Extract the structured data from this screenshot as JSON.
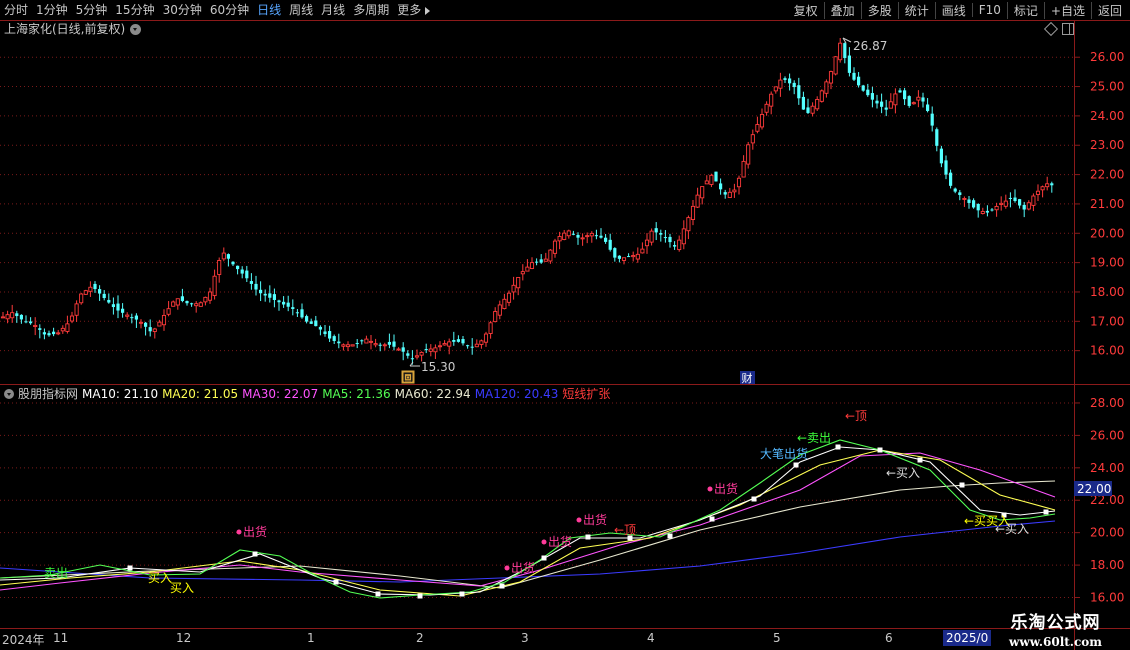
{
  "toolbar": {
    "periods": [
      "分时",
      "1分钟",
      "5分钟",
      "15分钟",
      "30分钟",
      "60分钟",
      "日线",
      "周线",
      "月线",
      "多周期",
      "更多"
    ],
    "active_period": "日线",
    "right_buttons": [
      "复权",
      "叠加",
      "多股",
      "统计",
      "画线",
      "F10",
      "标记",
      "+自选",
      "返回"
    ]
  },
  "stock_title": "上海家化(日线,前复权)",
  "main_chart": {
    "high_label": "26.87",
    "low_label": "15.30",
    "price_ticks": [
      "26.00",
      "25.00",
      "24.00",
      "23.00",
      "22.00",
      "21.00",
      "20.00",
      "19.00",
      "18.00",
      "17.00",
      "16.00"
    ],
    "price_range": [
      15.0,
      27.2
    ],
    "cai_marker": "财",
    "low_marker": "回",
    "colors": {
      "up": "#ff3b3b",
      "down": "#54ffff"
    }
  },
  "indicator": {
    "name": "股朋指标网",
    "ma_legend": [
      {
        "label": "MA10",
        "value": "21.10",
        "color": "#ffffff"
      },
      {
        "label": "MA20",
        "value": "21.05",
        "color": "#ffff54"
      },
      {
        "label": "MA30",
        "value": "22.07",
        "color": "#ff54ff"
      },
      {
        "label": "MA5",
        "value": "21.36",
        "color": "#54ff54"
      },
      {
        "label": "MA60",
        "value": "22.94",
        "color": "#e8e8d0"
      },
      {
        "label": "MA120",
        "value": "20.43",
        "color": "#3b3bff"
      }
    ],
    "tag": "短线扩张",
    "ticks": [
      "28.00",
      "26.00",
      "24.00",
      "22.00",
      "20.00",
      "18.00",
      "16.00"
    ],
    "current_value": "22.00",
    "annotations": {
      "sell_a": "卖出",
      "buy_a": "买入",
      "buy_b": "买入",
      "ship_1": "出货",
      "ship_2": "出货",
      "ship_3": "出货",
      "ship_4": "出货",
      "ship_5": "出货",
      "top_1": "←顶",
      "sell_b": "←卖出",
      "big_ship": "大笔出货",
      "top_2": "←顶",
      "buy_c": "←买入",
      "buy_d": "←买买入",
      "buy_e": "←买入"
    }
  },
  "x_axis": {
    "labels": [
      "2024年",
      "11",
      "12",
      "1",
      "2",
      "3",
      "4",
      "5",
      "6"
    ],
    "current_date": "2025/0"
  },
  "watermark": {
    "cn": "乐淘公式网",
    "url": "www.60lt.com"
  }
}
